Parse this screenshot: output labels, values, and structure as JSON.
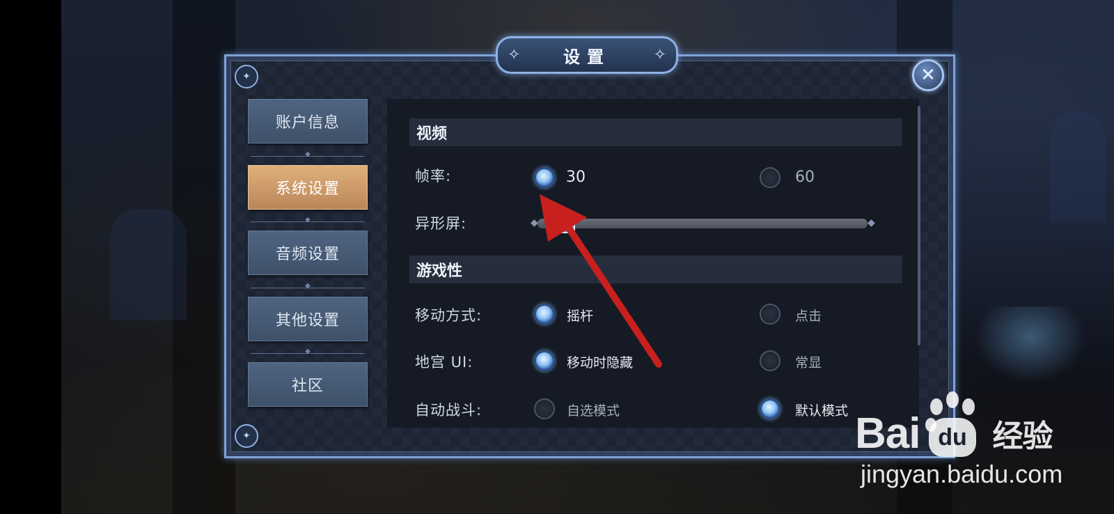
{
  "dialog": {
    "title": "设置",
    "close_label": "✕"
  },
  "sidebar": {
    "items": [
      {
        "label": "账户信息",
        "active": false
      },
      {
        "label": "系统设置",
        "active": true
      },
      {
        "label": "音频设置",
        "active": false
      },
      {
        "label": "其他设置",
        "active": false
      },
      {
        "label": "社区",
        "active": false
      }
    ]
  },
  "video": {
    "header": "视频",
    "framerate": {
      "label": "帧率:",
      "options": [
        "30",
        "60"
      ],
      "selected": "30"
    },
    "notch": {
      "label": "异形屏:",
      "slider_level": 0.05
    }
  },
  "gameplay": {
    "header": "游戏性",
    "movement": {
      "label": "移动方式:",
      "options": [
        "摇杆",
        "点击"
      ],
      "selected": "摇杆"
    },
    "dungeon_ui": {
      "label": "地宫 UI:",
      "options": [
        "移动时隐藏",
        "常显"
      ],
      "selected": "移动时隐藏"
    },
    "auto_battle": {
      "label": "自动战斗:",
      "options": [
        "自选模式",
        "默认模式"
      ],
      "selected": "默认模式"
    }
  },
  "watermark": {
    "brand_left": "Bai",
    "brand_mid": "du",
    "brand_right": "经验",
    "url": "jingyan.baidu.com"
  },
  "annotation_color": "#c8201e"
}
